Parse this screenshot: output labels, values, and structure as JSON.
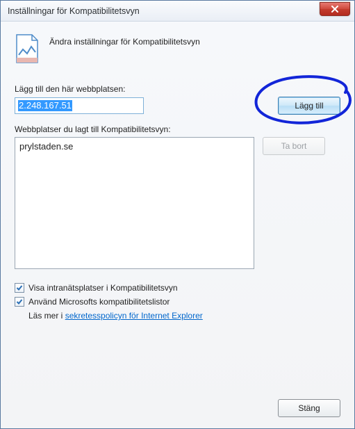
{
  "window": {
    "title": "Inställningar för Kompatibilitetsvyn",
    "close_icon": "close-icon"
  },
  "header": {
    "icon": "compat-doc-icon",
    "text": "Ändra inställningar för Kompatibilitetsvyn"
  },
  "add": {
    "label": "Lägg till den här webbplatsen:",
    "value": "2.248.167.51",
    "button": "Lägg till"
  },
  "list": {
    "label": "Webbplatser du lagt till Kompatibilitetsvyn:",
    "items": [
      "prylstaden.se"
    ],
    "remove_button": "Ta bort"
  },
  "options": {
    "intranet": "Visa intranätsplatser i Kompatibilitetsvyn",
    "ms_lists": "Använd Microsofts kompatibilitetslistor",
    "readmore_prefix": "Läs mer i ",
    "readmore_link": "sekretesspolicyn för Internet Explorer"
  },
  "footer": {
    "close_button": "Stäng"
  }
}
